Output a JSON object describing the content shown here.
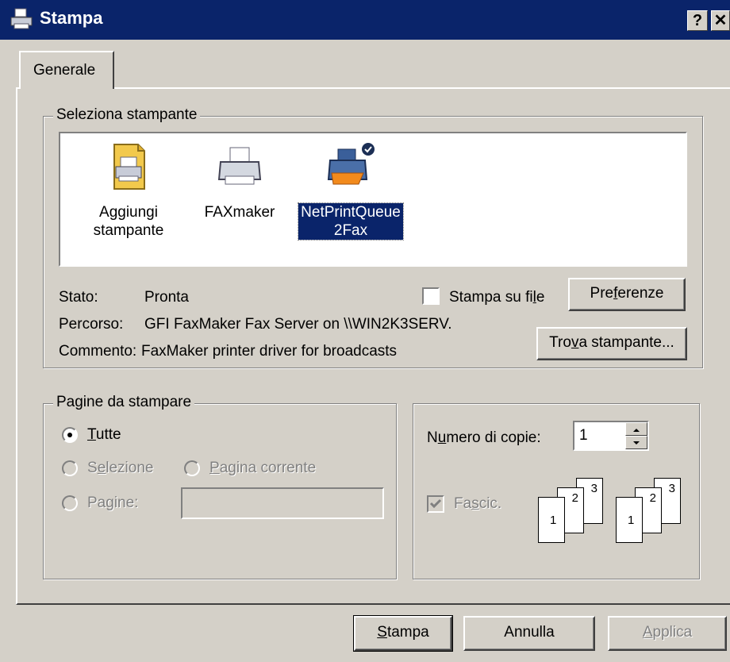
{
  "window": {
    "title": "Stampa",
    "help_glyph": "?",
    "close_glyph": "✕"
  },
  "tabs": [
    {
      "label": "Generale"
    }
  ],
  "select_printer": {
    "group_label": "Seleziona stampante",
    "printers": [
      {
        "label_line1": "Aggiungi",
        "label_line2": "stampante",
        "icon": "add-printer-icon",
        "selected": false
      },
      {
        "label_line1": "FAXmaker",
        "label_line2": "",
        "icon": "printer-icon",
        "selected": false
      },
      {
        "label_line1": "NetPrintQueue",
        "label_line2": "2Fax",
        "icon": "network-printer-icon",
        "selected": true
      }
    ],
    "status_label": "Stato:",
    "status_value": "Pronta",
    "path_label": "Percorso:",
    "path_value": "GFI FaxMaker Fax Server on \\\\WIN2K3SERV.",
    "comment_label": "Commento:",
    "comment_value": "FaxMaker printer driver for broadcasts",
    "print_to_file": {
      "label_pre": "Stampa su fi",
      "label_accel": "l",
      "label_post": "e",
      "checked": false
    },
    "preferences_button": {
      "pre": "Pre",
      "accel": "f",
      "post": "erenze"
    },
    "find_printer_button": {
      "pre": "Tro",
      "accel": "v",
      "post": "a stampante..."
    }
  },
  "page_range": {
    "group_label": "Pagine da stampare",
    "all": {
      "accel": "T",
      "rest": "utte",
      "selected": true
    },
    "selection": {
      "pre": "S",
      "accel": "e",
      "post": "lezione",
      "enabled": false
    },
    "current_page": {
      "accel": "P",
      "rest": "agina corrente",
      "enabled": false
    },
    "pages": {
      "pre": "Pa",
      "accel": "g",
      "post": "ine:",
      "enabled": false,
      "value": ""
    }
  },
  "copies": {
    "label_pre": "N",
    "label_accel": "u",
    "label_post": "mero di copie:",
    "value": "1",
    "collate": {
      "pre": "Fa",
      "accel": "s",
      "post": "cic.",
      "checked": true,
      "enabled": false
    },
    "page_numbers": [
      "1",
      "2",
      "3"
    ]
  },
  "footer": {
    "print_button": {
      "accel": "S",
      "rest": "tampa"
    },
    "cancel_button": "Annulla",
    "apply_button": {
      "accel": "A",
      "rest": "pplica",
      "enabled": false
    }
  }
}
